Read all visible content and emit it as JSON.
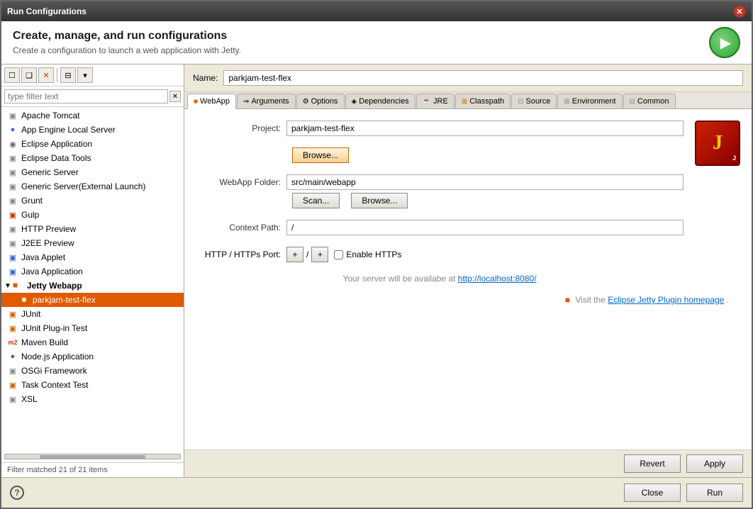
{
  "window": {
    "title": "Run Configurations"
  },
  "header": {
    "title": "Create, manage, and run configurations",
    "subtitle": "Create a configuration to launch a web application with Jetty."
  },
  "sidebar": {
    "toolbar": {
      "new_label": "☐",
      "duplicate_label": "❑",
      "delete_label": "✕",
      "filter_label": "⊟",
      "combo_label": "▾"
    },
    "filter": {
      "placeholder": "type filter text",
      "value": ""
    },
    "items": [
      {
        "id": "apache-tomcat",
        "label": "Apache Tomcat",
        "indent": 0,
        "icon": "server"
      },
      {
        "id": "app-engine",
        "label": "App Engine Local Server",
        "indent": 0,
        "icon": "circle-blue"
      },
      {
        "id": "eclipse-app",
        "label": "Eclipse Application",
        "indent": 0,
        "icon": "circle-gray"
      },
      {
        "id": "eclipse-data",
        "label": "Eclipse Data Tools",
        "indent": 0,
        "icon": "square-gray"
      },
      {
        "id": "generic-server",
        "label": "Generic Server",
        "indent": 0,
        "icon": "square-gray"
      },
      {
        "id": "generic-server-ext",
        "label": "Generic Server(External Launch)",
        "indent": 0,
        "icon": "square-gray"
      },
      {
        "id": "grunt",
        "label": "Grunt",
        "indent": 0,
        "icon": "square-gray"
      },
      {
        "id": "gulp",
        "label": "Gulp",
        "indent": 0,
        "icon": "square-red"
      },
      {
        "id": "http-preview",
        "label": "HTTP Preview",
        "indent": 0,
        "icon": "square-gray"
      },
      {
        "id": "j2ee-preview",
        "label": "J2EE Preview",
        "indent": 0,
        "icon": "square-gray"
      },
      {
        "id": "java-applet",
        "label": "Java Applet",
        "indent": 0,
        "icon": "square-blue"
      },
      {
        "id": "java-application",
        "label": "Java Application",
        "indent": 0,
        "icon": "square-blue"
      },
      {
        "id": "jetty-webapp",
        "label": "Jetty Webapp",
        "indent": 0,
        "icon": "jetty",
        "group": true,
        "expanded": true
      },
      {
        "id": "parkjam-test-flex",
        "label": "parkjam-test-flex",
        "indent": 1,
        "icon": "jetty",
        "selected": true
      },
      {
        "id": "junit",
        "label": "JUnit",
        "indent": 0,
        "icon": "junit"
      },
      {
        "id": "junit-plugin",
        "label": "JUnit Plug-in Test",
        "indent": 0,
        "icon": "junit"
      },
      {
        "id": "maven-build",
        "label": "Maven Build",
        "indent": 0,
        "icon": "maven"
      },
      {
        "id": "nodejs-app",
        "label": "Node.js Application",
        "indent": 0,
        "icon": "node"
      },
      {
        "id": "osgi",
        "label": "OSGi Framework",
        "indent": 0,
        "icon": "square-gray"
      },
      {
        "id": "task-context",
        "label": "Task Context Test",
        "indent": 0,
        "icon": "junit"
      },
      {
        "id": "xsl",
        "label": "XSL",
        "indent": 0,
        "icon": "square-gray"
      }
    ],
    "footer": "Filter matched 21 of 21 items"
  },
  "main": {
    "name_label": "Name:",
    "name_value": "parkjam-test-flex",
    "tabs": [
      {
        "id": "webapp",
        "label": "WebApp",
        "icon": "jetty",
        "active": true
      },
      {
        "id": "arguments",
        "label": "Arguments",
        "icon": "args"
      },
      {
        "id": "options",
        "label": "Options",
        "icon": "options"
      },
      {
        "id": "dependencies",
        "label": "Dependencies",
        "icon": "deps"
      },
      {
        "id": "jre",
        "label": "JRE",
        "icon": "jre"
      },
      {
        "id": "classpath",
        "label": "Classpath",
        "icon": "classpath"
      },
      {
        "id": "source",
        "label": "Source",
        "icon": "source"
      },
      {
        "id": "environment",
        "label": "Environment",
        "icon": "env"
      },
      {
        "id": "common",
        "label": "Common",
        "icon": "common"
      }
    ],
    "form": {
      "project_label": "Project:",
      "project_value": "parkjam-test-flex",
      "browse_label": "Browse...",
      "webapp_folder_label": "WebApp Folder:",
      "webapp_folder_value": "src/main/webapp",
      "scan_label": "Scan...",
      "browse2_label": "Browse...",
      "context_path_label": "Context Path:",
      "context_path_value": "/",
      "http_port_label": "HTTP / HTTPs Port:",
      "port_plus1": "+",
      "port_sep": "/",
      "port_plus2": "+",
      "enable_https_label": "Enable HTTPs",
      "server_info": "Your server will be availabe at ",
      "server_url": "http://localhost:8080/",
      "jetty_logo_text": "J",
      "visit_text": "Visit the ",
      "visit_link": "Eclipse Jetty Plugin homepage",
      "visit_suffix": "."
    }
  },
  "bottom": {
    "revert_label": "Revert",
    "apply_label": "Apply",
    "close_label": "Close",
    "run_label": "Run"
  }
}
